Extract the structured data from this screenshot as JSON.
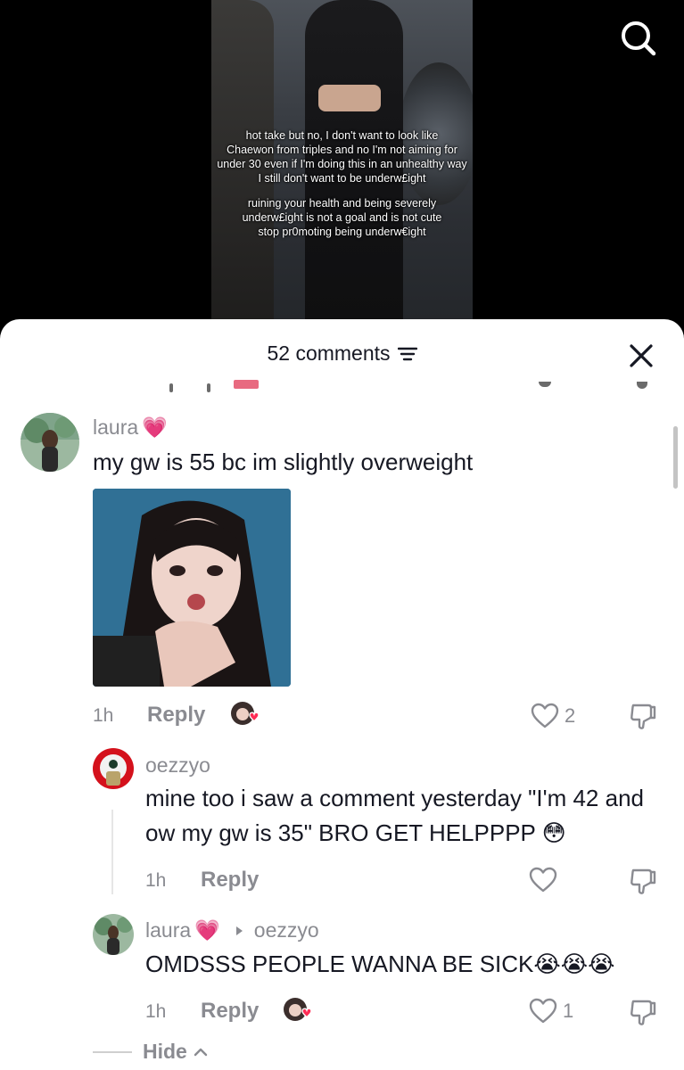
{
  "video": {
    "caption_paragraph_1": "hot take but no, I don't want to look like\nChaewon from triples and no I'm not aiming for\nunder 30 even if I'm doing this in an unhealthy way\nI still don't want to be underw£ight",
    "caption_paragraph_2": "ruining your health and being severely\nunderw£ight is not a goal and is not cute\nstop pr0moting being underw€ight"
  },
  "sheet": {
    "comment_count_label": "52 comments"
  },
  "comments": [
    {
      "username": "laura",
      "username_emoji": "💗",
      "text": "my gw is 55 bc im slightly overweight",
      "time": "1h",
      "reply_label": "Reply",
      "like_count": "2"
    },
    {
      "username": "oezzyo",
      "text": "mine too i saw a comment yesterday \"I'm 42 and ow my gw is 35\" BRO GET HELPPPP 😳",
      "time": "1h",
      "reply_label": "Reply",
      "like_count": ""
    },
    {
      "username": "laura",
      "username_emoji": "💗",
      "reply_to": "oezzyo",
      "text": "OMDSSS PEOPLE WANNA BE SICK😭😭😭",
      "time": "1h",
      "reply_label": "Reply",
      "like_count": "1"
    }
  ],
  "hide_label": "Hide",
  "colors": {
    "sheet_bg": "#ffffff",
    "text_primary": "#161823",
    "text_secondary": "#8a8b91",
    "heart_accent": "#fe2c55"
  }
}
